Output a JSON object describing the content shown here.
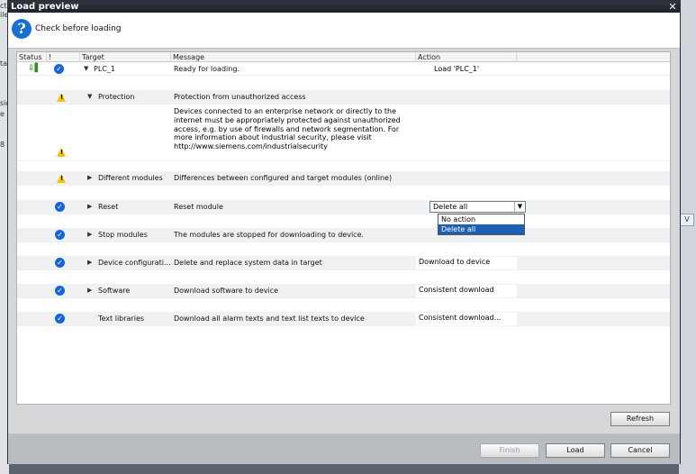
{
  "background": {
    "left_fragments": [
      "ct",
      "ile",
      "ta",
      "sic",
      "e",
      "8"
    ],
    "right_button": "V"
  },
  "dialog": {
    "title": "Load preview",
    "close_symbol": "✕",
    "header_text": "Check before loading",
    "help_symbol": "?"
  },
  "table": {
    "columns": {
      "status": "Status",
      "bang": "!",
      "target": "Target",
      "message": "Message",
      "action": "Action"
    },
    "rows": [
      {
        "target": "PLC_1",
        "message": "Ready for loading.",
        "action": "Load 'PLC_1'"
      },
      {
        "target": "Protection",
        "message": "Protection from unauthorized access"
      },
      {
        "message": "Devices connected to an enterprise network or directly to the internet must be appropriately protected against unauthorized access, e.g. by use of firewalls and network segmentation. For more information about industrial security, please visit http://www.siemens.com/industrialsecurity"
      },
      {
        "target": "Different modules",
        "message": "Differences between configured and target modules (online)"
      },
      {
        "target": "Reset",
        "message": "Reset module",
        "action": "Delete all"
      },
      {
        "target": "Stop modules",
        "message": "The modules are stopped for downloading to device."
      },
      {
        "target": "Device configurati...",
        "message": "Delete and replace system data in target",
        "action": "Download to device"
      },
      {
        "target": "Software",
        "message": "Download software to device",
        "action": "Consistent download"
      },
      {
        "target": "Text libraries",
        "message": "Download all alarm texts and text list texts to device",
        "action": "Consistent download..."
      }
    ],
    "dropdown": {
      "options": [
        "No action",
        "Delete all"
      ],
      "selected": "Delete all"
    }
  },
  "buttons": {
    "refresh": "Refresh",
    "finish": "Finish",
    "load": "Load",
    "cancel": "Cancel"
  }
}
